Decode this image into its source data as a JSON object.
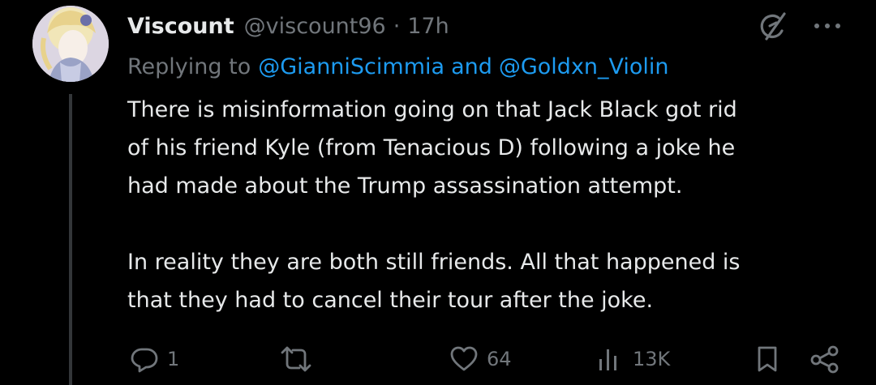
{
  "tweet": {
    "display_name": "Viscount",
    "handle": "@viscount96",
    "separator": "·",
    "time": "17h",
    "reply": {
      "prefix": "Replying to",
      "mention1": "@GianniScimmia",
      "and": "and",
      "mention2": "@Goldxn_Violin"
    },
    "body": {
      "p1_l1": "There is misinformation going on that Jack Black got rid",
      "p1_l2": "of his friend Kyle (from Tenacious D) following a joke he",
      "p1_l3": "had made about the Trump assassination attempt.",
      "p2_l1": "In reality they are both still friends. All that happened is",
      "p2_l2": "that they had to cancel their tour after the joke."
    },
    "actions": {
      "replies": "1",
      "retweets": "",
      "likes": "64",
      "views": "13K"
    }
  },
  "icons": {
    "avatar": "anime-avatar",
    "grok": "grok-icon",
    "more": "more-icon",
    "reply": "reply-icon",
    "retweet": "retweet-icon",
    "like": "heart-icon",
    "views": "views-icon",
    "bookmark": "bookmark-icon",
    "share": "share-icon"
  },
  "colors": {
    "background": "#000000",
    "text": "#e7e9ea",
    "secondary": "#71767b",
    "link": "#1d9bf0",
    "thread_line": "#333639"
  }
}
